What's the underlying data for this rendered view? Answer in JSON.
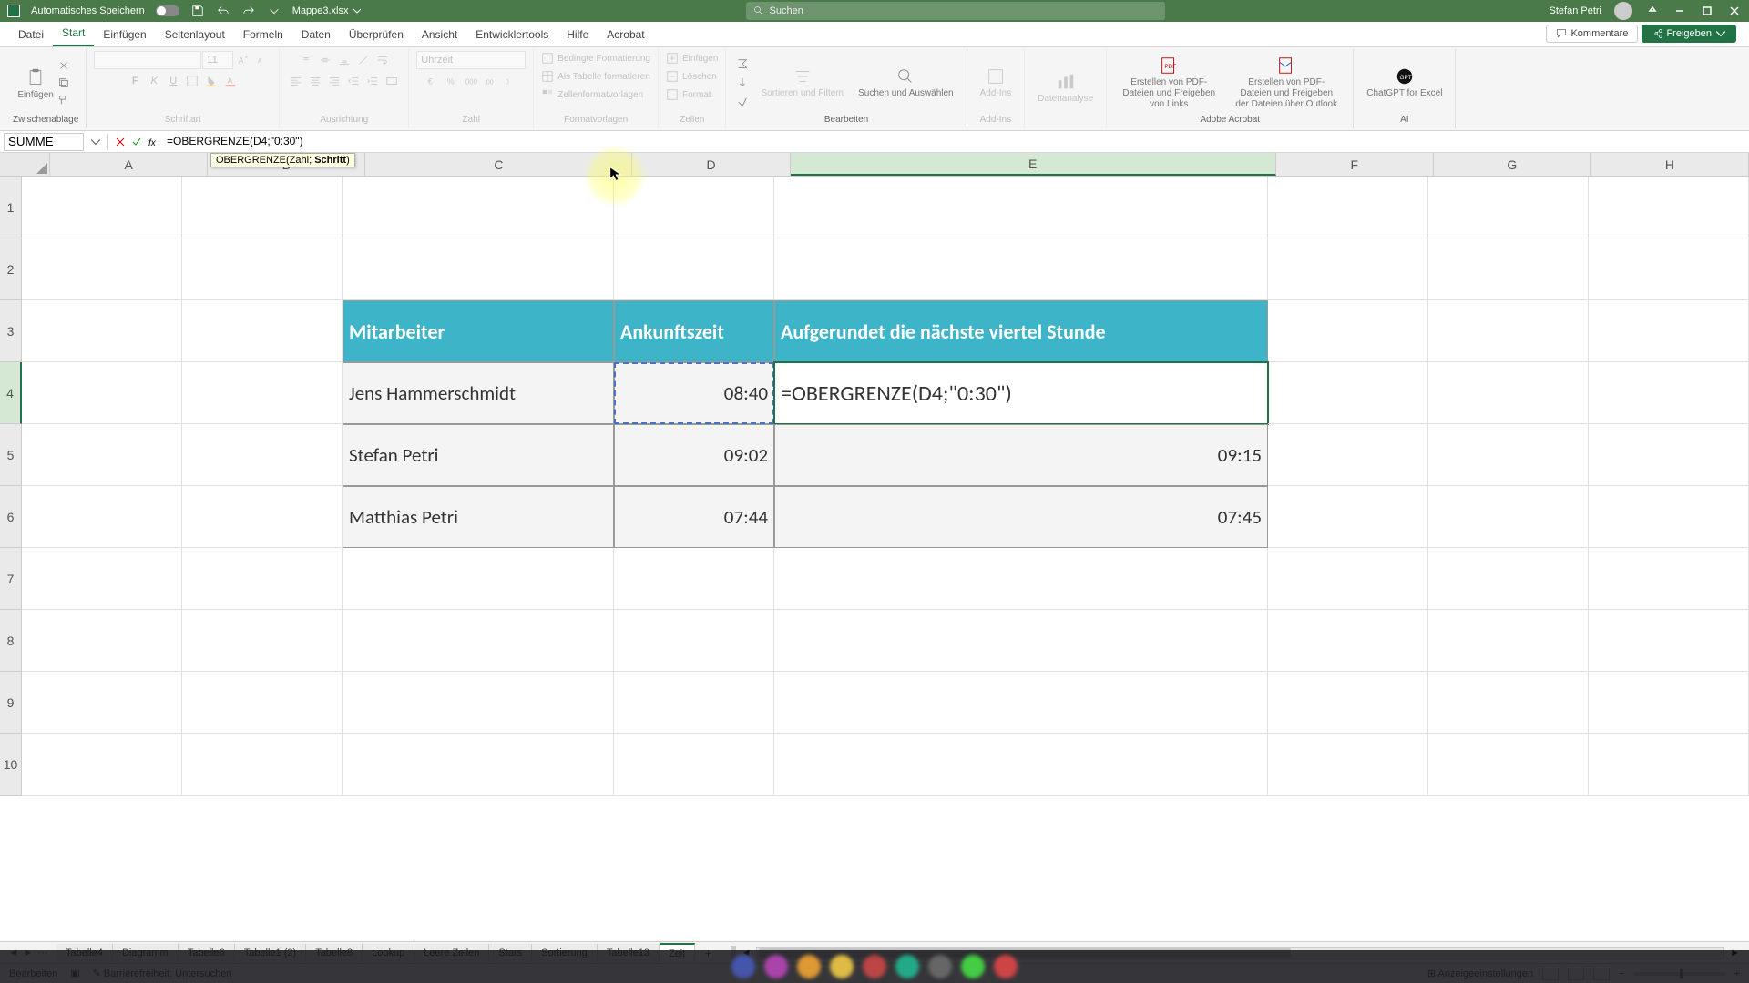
{
  "titlebar": {
    "autosave_label": "Automatisches Speichern",
    "filename": "Mappe3.xlsx",
    "search_placeholder": "Suchen",
    "username": "Stefan Petri"
  },
  "ribbon_tabs": {
    "datei": "Datei",
    "start": "Start",
    "einfuegen": "Einfügen",
    "seitenlayout": "Seitenlayout",
    "formeln": "Formeln",
    "daten": "Daten",
    "ueberpruefen": "Überprüfen",
    "ansicht": "Ansicht",
    "entwicklertools": "Entwicklertools",
    "hilfe": "Hilfe",
    "acrobat": "Acrobat",
    "kommentare": "Kommentare",
    "freigeben": "Freigeben"
  },
  "ribbon_groups": {
    "clipboard": {
      "label": "Zwischenablage",
      "paste": "Einfügen"
    },
    "font": {
      "label": "Schriftart",
      "size_placeholder": "11"
    },
    "alignment": {
      "label": "Ausrichtung"
    },
    "number": {
      "label": "Zahl",
      "format_placeholder": "Uhrzeit"
    },
    "styles": {
      "label": "Formatvorlagen",
      "conditional": "Bedingte Formatierung",
      "as_table": "Als Tabelle formatieren",
      "cell_styles": "Zellenformatvorlagen"
    },
    "cells": {
      "label": "Zellen",
      "insert": "Einfügen",
      "delete": "Löschen",
      "format": "Format"
    },
    "editing": {
      "label": "Bearbeiten",
      "sort": "Sortieren und Filtern",
      "find": "Suchen und Auswählen"
    },
    "addins": {
      "label": "Add-Ins",
      "addins": "Add-Ins"
    },
    "analysis": {
      "label": " ",
      "data_analysis": "Datenanalyse"
    },
    "acrobat": {
      "label": "Adobe Acrobat",
      "pdf_links": "Erstellen von PDF-Dateien und Freigeben von Links",
      "pdf_outlook": "Erstellen von PDF-Dateien und Freigeben der Dateien über Outlook"
    },
    "ai": {
      "label": "AI",
      "chatgpt": "ChatGPT for Excel"
    }
  },
  "formula_bar": {
    "namebox": "SUMME",
    "formula": "=OBERGRENZE(D4;\"0:30\")",
    "tooltip_fn": "OBERGRENZE(",
    "tooltip_arg1": "Zahl",
    "tooltip_sep": "; ",
    "tooltip_arg2": "Schritt",
    "tooltip_end": ")"
  },
  "columns": {
    "A": "A",
    "B": "B",
    "C": "C",
    "D": "D",
    "E": "E",
    "F": "F",
    "G": "G",
    "H": "H"
  },
  "rows": {
    "r1": "1",
    "r2": "2",
    "r3": "3",
    "r4": "4",
    "r5": "5",
    "r6": "6",
    "r7": "7",
    "r8": "8",
    "r9": "9",
    "r10": "10"
  },
  "table": {
    "header": {
      "mitarbeiter": "Mitarbeiter",
      "ankunft": "Ankunftszeit",
      "aufgerundet": "Aufgerundet die nächste viertel Stunde"
    },
    "rows": [
      {
        "name": "Jens Hammerschmidt",
        "time": "08:40",
        "rounded": "=OBERGRENZE(D4;\"0:30\")"
      },
      {
        "name": "Stefan Petri",
        "time": "09:02",
        "rounded": "09:15"
      },
      {
        "name": "Matthias Petri",
        "time": "07:44",
        "rounded": "07:45"
      }
    ]
  },
  "sheet_tabs": {
    "t0": "Tabelle4",
    "t1": "Diagramm",
    "t2": "Tabelle6",
    "t3": "Tabelle1 (2)",
    "t4": "Tabelle8",
    "t5": "Lookup",
    "t6": "Leere Zeilen",
    "t7": "Stars",
    "t8": "Sortierung",
    "t9": "Tabelle13",
    "active": "Zeit"
  },
  "status": {
    "mode": "Bearbeiten",
    "accessibility": "Barrierefreiheit: Untersuchen",
    "display_settings": "Anzeigeeinstellungen"
  }
}
